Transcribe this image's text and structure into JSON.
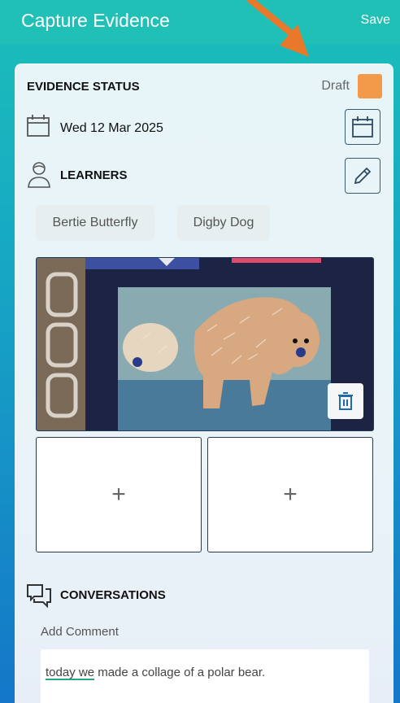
{
  "appbar": {
    "title": "Capture Evidence",
    "save_label": "Save"
  },
  "status": {
    "label": "EVIDENCE STATUS",
    "value": "Draft",
    "color": "#f29a4a"
  },
  "date": {
    "value": "Wed 12 Mar 2025"
  },
  "learners": {
    "label": "LEARNERS",
    "items": [
      "Bertie Butterfly",
      "Digby Dog"
    ]
  },
  "media": {
    "add_symbol": "+"
  },
  "conversations": {
    "label": "CONVERSATIONS",
    "add_comment_label": "Add Comment",
    "comment_marked": "today we",
    "comment_rest": " made a collage of a polar bear."
  },
  "colors": {
    "appbar": "#20c0b7",
    "accent_arrow": "#e9782a"
  },
  "icons": [
    "calendar-icon",
    "person-icon",
    "pencil-icon",
    "trash-icon",
    "chat-icon"
  ]
}
